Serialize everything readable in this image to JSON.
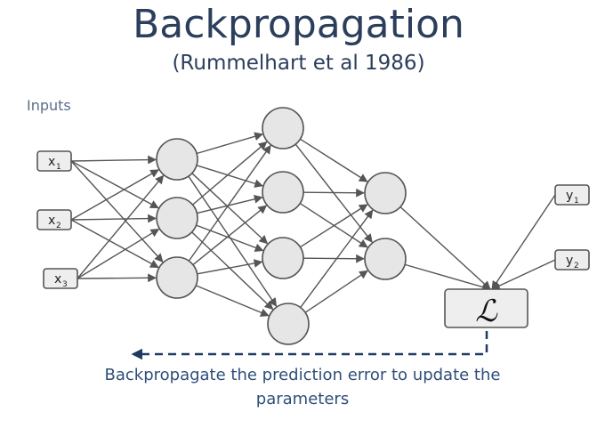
{
  "title": "Backpropagation",
  "subtitle": "(Rummelhart et al 1986)",
  "inputs_label": "Inputs",
  "inputs": [
    {
      "base": "x",
      "sub": "1"
    },
    {
      "base": "x",
      "sub": "2"
    },
    {
      "base": "x",
      "sub": "3"
    }
  ],
  "targets": [
    {
      "base": "y",
      "sub": "1"
    },
    {
      "base": "y",
      "sub": "2"
    }
  ],
  "loss_symbol": "ℒ",
  "caption": "Backpropagate the prediction error to update the parameters",
  "colors": {
    "title": "#2b3e5c",
    "caption": "#2f4e7a",
    "arrow": "#1f3a64",
    "node_fill": "#e6e6e6",
    "stroke": "#555555"
  }
}
